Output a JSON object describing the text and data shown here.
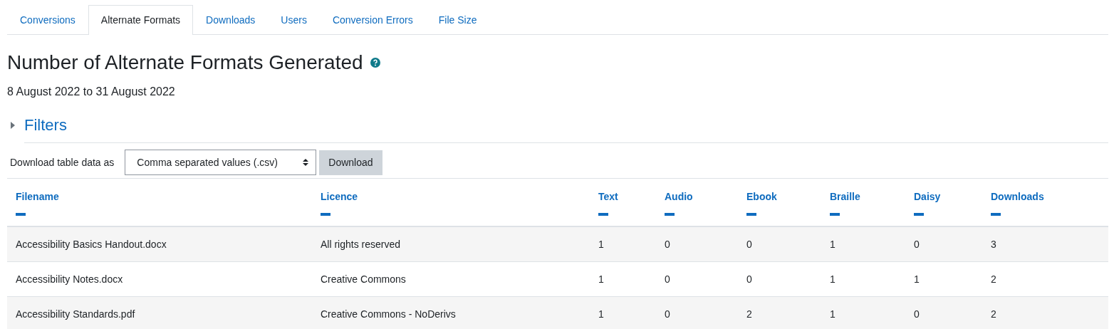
{
  "tabs": [
    {
      "label": "Conversions",
      "selected": false
    },
    {
      "label": "Alternate Formats",
      "selected": true
    },
    {
      "label": "Downloads",
      "selected": false
    },
    {
      "label": "Users",
      "selected": false
    },
    {
      "label": "Conversion Errors",
      "selected": false
    },
    {
      "label": "File Size",
      "selected": false
    }
  ],
  "heading": "Number of Alternate Formats Generated",
  "date_range": "8 August 2022 to 31 August 2022",
  "filters": {
    "label": "Filters",
    "expanded": false
  },
  "download": {
    "label": "Download table data as",
    "format": "Comma separated values (.csv)",
    "button": "Download"
  },
  "table": {
    "columns": [
      "Filename",
      "Licence",
      "Text",
      "Audio",
      "Ebook",
      "Braille",
      "Daisy",
      "Downloads"
    ],
    "rows": [
      [
        "Accessibility Basics Handout.docx",
        "All rights reserved",
        "1",
        "0",
        "0",
        "1",
        "0",
        "3"
      ],
      [
        "Accessibility Notes.docx",
        "Creative Commons",
        "1",
        "0",
        "0",
        "1",
        "1",
        "2"
      ],
      [
        "Accessibility Standards.pdf",
        "Creative Commons - NoDerivs",
        "1",
        "0",
        "2",
        "1",
        "0",
        "2"
      ]
    ]
  }
}
